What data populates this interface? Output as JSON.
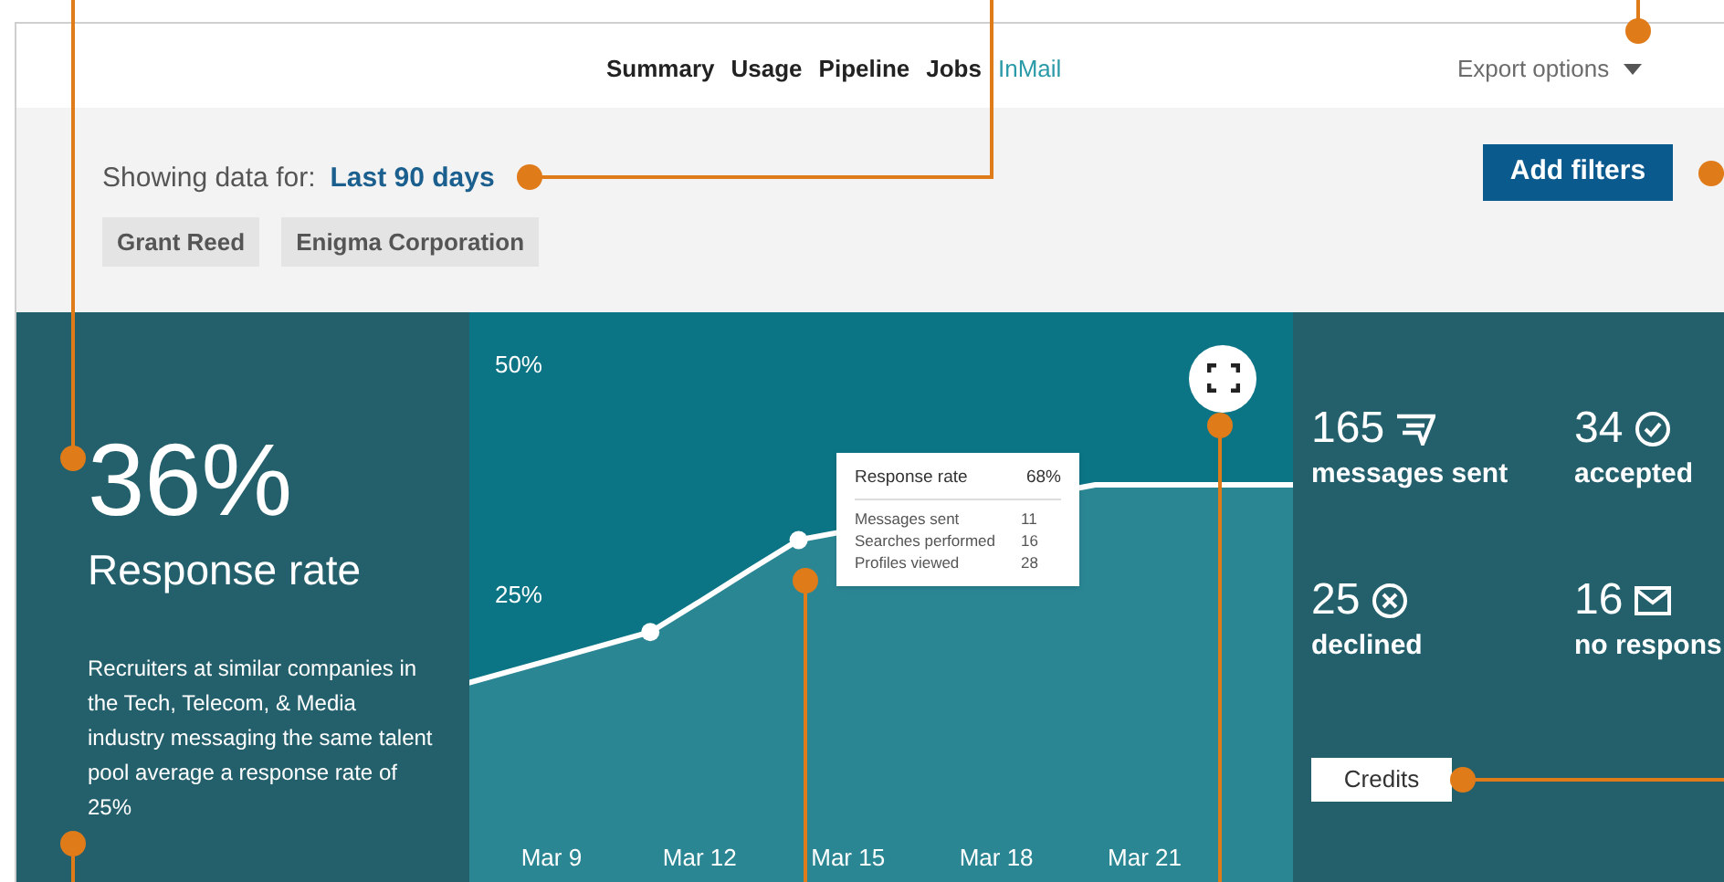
{
  "nav": [
    {
      "label": "Summary",
      "selected": false
    },
    {
      "label": "Usage",
      "selected": false
    },
    {
      "label": "Pipeline",
      "selected": false
    },
    {
      "label": "Jobs",
      "selected": false
    },
    {
      "label": "InMail",
      "selected": true
    }
  ],
  "export_menu": {
    "label": "Export options"
  },
  "filters": {
    "label": "Showing data for:",
    "range": "Last 90 days",
    "chips": [
      "Grant Reed",
      "Enigma Corporation"
    ],
    "button": "Add filters"
  },
  "summary": {
    "value": "36%",
    "label": "Response rate",
    "note": "Recruiters at similar companies in the Tech, Telecom, & Media industry messaging the same talent pool average a response rate of 25%"
  },
  "chart": {
    "chart_data": {
      "type": "area",
      "categories": [
        null,
        null,
        "Mar 9",
        null,
        null,
        "Mar 12",
        null,
        null,
        "Mar 15",
        null,
        null,
        "Mar 18",
        null,
        null,
        "Mar 21",
        null,
        null,
        null
      ],
      "series": [
        {
          "name": "Response rate",
          "color": "#ffffff",
          "values": [
            15,
            16.5,
            18,
            19.5,
            21,
            24.3,
            27.7,
            31,
            null,
            null,
            null,
            null,
            null,
            37,
            37,
            37,
            37,
            37
          ]
        }
      ],
      "ylim": [
        -6.35,
        55.75
      ],
      "yticks": [
        {
          "value": 25,
          "label": "25%"
        },
        {
          "value": 50,
          "label": "50%"
        }
      ]
    },
    "tooltip": {
      "title_value": "68%",
      "rows": [
        {
          "label": "Messages sent",
          "value": "11"
        },
        {
          "label": "Searches performed",
          "value": "16"
        },
        {
          "label": "Profiles viewed",
          "value": "28"
        }
      ]
    }
  },
  "stats": [
    {
      "value": "165",
      "label": "messages sent",
      "kind": "sent"
    },
    {
      "value": "34",
      "label": "accepted",
      "kind": "accepted"
    },
    {
      "value": "25",
      "label": "declined",
      "kind": "declined"
    },
    {
      "value": "16",
      "label": "no respons",
      "kind": "none"
    }
  ],
  "credits_button": "Credits"
}
